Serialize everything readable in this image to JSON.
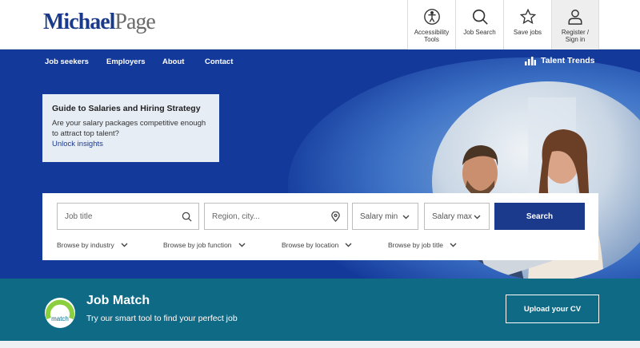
{
  "header": {
    "logo_part1": "Michael",
    "logo_part2": "Page",
    "tools": [
      {
        "label": "Accessibility\nTools",
        "icon": "accessibility-icon"
      },
      {
        "label": "Job Search",
        "icon": "search-icon"
      },
      {
        "label": "Save jobs",
        "icon": "star-icon"
      },
      {
        "label": "Register /\nSign in",
        "icon": "user-icon"
      }
    ]
  },
  "nav": {
    "items": [
      "Job seekers",
      "Employers",
      "About",
      "Contact"
    ],
    "talent_trends": "Talent Trends"
  },
  "promo": {
    "title": "Guide to Salaries and Hiring Strategy",
    "description": "Are your salary packages competitive enough to attract top talent?",
    "link": "Unlock insights"
  },
  "search": {
    "job_title_placeholder": "Job title",
    "region_placeholder": "Region, city...",
    "salary_min": "Salary min",
    "salary_max": "Salary max",
    "button": "Search",
    "browse": [
      "Browse by industry",
      "Browse by job function",
      "Browse by location",
      "Browse by job title"
    ]
  },
  "job_match": {
    "badge": "match",
    "title": "Job Match",
    "subtitle": "Try our smart tool to find your perfect job",
    "button": "Upload your CV"
  },
  "colors": {
    "brand_blue": "#1b3a8c",
    "hero_blue": "#13399a",
    "band_teal": "#0f6a86",
    "accent_green": "#8ccf3e"
  }
}
